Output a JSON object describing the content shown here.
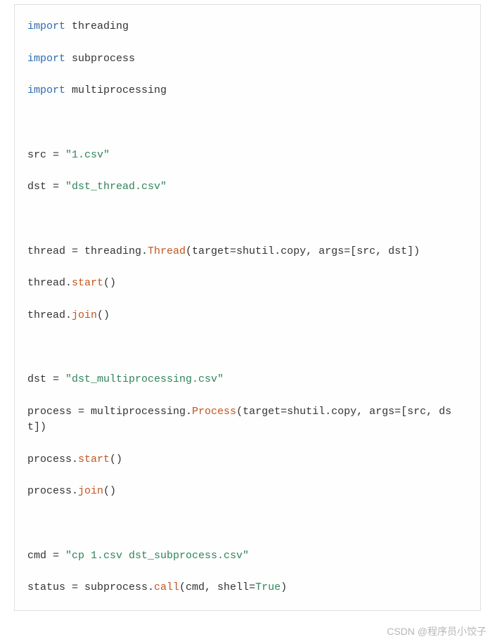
{
  "code": {
    "l1_kw": "import",
    "l1_nm": " threading",
    "l2_kw": "import",
    "l2_nm": " subprocess",
    "l3_kw": "import",
    "l3_nm": " multiprocessing",
    "l4_a": "src = ",
    "l4_s": "\"1.csv\"",
    "l5_a": "dst = ",
    "l5_s": "\"dst_thread.csv\"",
    "l6_a": "thread = threading.",
    "l6_c": "Thread",
    "l6_b": "(target=shutil.copy, args=[src, dst])",
    "l7_a": "thread.",
    "l7_f": "start",
    "l7_b": "()",
    "l8_a": "thread.",
    "l8_f": "join",
    "l8_b": "()",
    "l9_a": "dst = ",
    "l9_s": "\"dst_multiprocessing.csv\"",
    "l10_a": "process = multiprocessing.",
    "l10_c": "Process",
    "l10_b": "(target=shutil.copy, args=[src, dst])",
    "l11_a": "process.",
    "l11_f": "start",
    "l11_b": "()",
    "l12_a": "process.",
    "l12_f": "join",
    "l12_b": "()",
    "l13_a": "cmd = ",
    "l13_s": "\"cp 1.csv dst_subprocess.csv\"",
    "l14_a": "status = subprocess.",
    "l14_f": "call",
    "l14_b": "(cmd, shell=",
    "l14_t": "True",
    "l14_c": ")"
  },
  "watermark": "CSDN @程序员小饺子"
}
